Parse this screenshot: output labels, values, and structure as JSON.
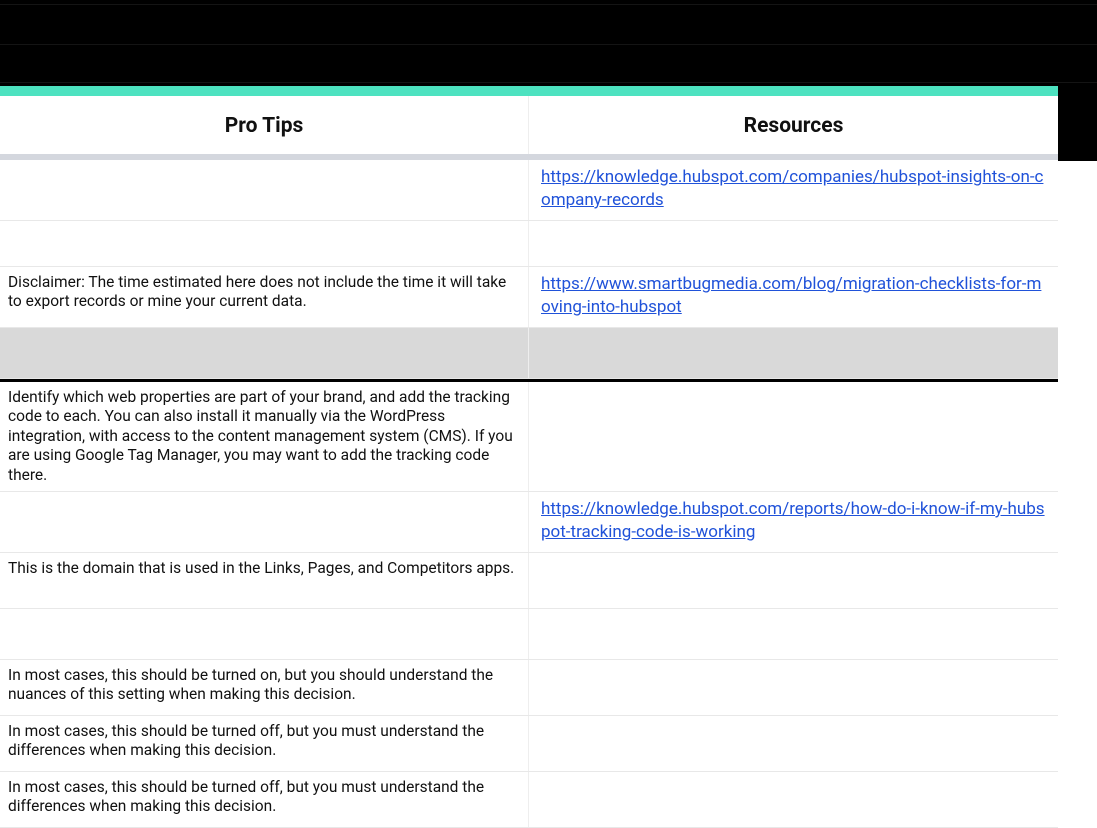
{
  "headers": {
    "col1": "Pro Tips",
    "col2": "Resources"
  },
  "rows": [
    {
      "height": "h60",
      "tip": "",
      "resource": "https://knowledge.hubspot.com/companies/hubspot-insights-on-company-records",
      "isLink": true
    },
    {
      "height": "h45",
      "tip": "",
      "resource": "",
      "isLink": false
    },
    {
      "height": "h60",
      "tip": "Disclaimer: The time estimated here does not include the time it will take to export records or mine your current data.",
      "resource": "https://www.smartbugmedia.com/blog/migration-checklists-for-moving-into-hubspot",
      "isLink": true
    },
    {
      "height": "h50",
      "tip": "",
      "resource": "",
      "isLink": false,
      "gray": true
    },
    {
      "height": "h95",
      "tip": "Identify which web properties are part of your brand, and add the tracking code to each. You can also install it manually via the WordPress integration, with access to the content management system (CMS). If you are using Google Tag Manager, you may want to add the tracking code there.",
      "resource": "",
      "isLink": false,
      "afterThickSep": true
    },
    {
      "height": "h60",
      "tip": "",
      "resource": "https://knowledge.hubspot.com/reports/how-do-i-know-if-my-hubspot-tracking-code-is-working",
      "isLink": true
    },
    {
      "height": "h55",
      "tip": "This is the domain that is used in the Links, Pages, and Competitors apps.",
      "resource": "",
      "isLink": false
    },
    {
      "height": "h50",
      "tip": "",
      "resource": "",
      "isLink": false
    },
    {
      "height": "h55",
      "tip": "In most cases, this should be turned on, but you should understand the nuances of this setting when making this decision.",
      "resource": "",
      "isLink": false
    },
    {
      "height": "h55",
      "tip": "In most cases, this should be turned off, but you must understand the differences when making this decision.",
      "resource": "",
      "isLink": false
    },
    {
      "height": "h55",
      "tip": "In most cases, this should be turned off, but you must understand the differences when making this decision.",
      "resource": "",
      "isLink": false
    }
  ]
}
